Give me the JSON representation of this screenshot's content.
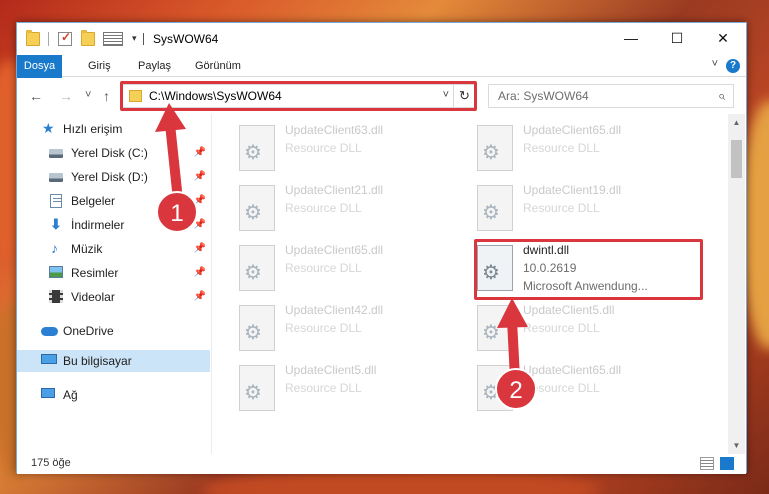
{
  "window": {
    "title": "SysWOW64",
    "minimize": "—",
    "maximize": "☐",
    "close": "✕"
  },
  "ribbon": {
    "tabs": [
      "Dosya",
      "Giriş",
      "Paylaş",
      "Görünüm"
    ],
    "help": "?"
  },
  "nav": {
    "back": "←",
    "forward": "→",
    "recent": "˅",
    "up": "↑",
    "address": "C:\\Windows\\SysWOW64",
    "address_dropdown": "˅",
    "refresh": "↻",
    "search_placeholder": "Ara: SysWOW64",
    "search_icon": "⌕"
  },
  "sidebar": {
    "items": [
      {
        "label": "Hızlı erişim",
        "icon": "star-icon",
        "pinned": false
      },
      {
        "label": "Yerel Disk (C:)",
        "icon": "drive-icon",
        "pinned": true
      },
      {
        "label": "Yerel Disk (D:)",
        "icon": "drive-icon",
        "pinned": true
      },
      {
        "label": "Belgeler",
        "icon": "documents-icon",
        "pinned": true
      },
      {
        "label": "İndirmeler",
        "icon": "download-icon",
        "pinned": true
      },
      {
        "label": "Müzik",
        "icon": "music-icon",
        "pinned": true
      },
      {
        "label": "Resimler",
        "icon": "pictures-icon",
        "pinned": true
      },
      {
        "label": "Videolar",
        "icon": "videos-icon",
        "pinned": true
      },
      {
        "label": "OneDrive",
        "icon": "cloud-icon",
        "pinned": false
      },
      {
        "label": "Bu bilgisayar",
        "icon": "computer-icon",
        "pinned": false,
        "selected": true
      },
      {
        "label": "Ağ",
        "icon": "network-icon",
        "pinned": false
      }
    ],
    "pin_glyph": "📌"
  },
  "files": [
    {
      "name": "UpdateClient63.dll",
      "type": "Resource DLL"
    },
    {
      "name": "UpdateClient65.dll",
      "type": "Resource DLL"
    },
    {
      "name": "UpdateClient21.dll",
      "type": "Resource DLL"
    },
    {
      "name": "UpdateClient19.dll",
      "type": "Resource DLL"
    },
    {
      "name": "UpdateClient65.dll",
      "type": "Resource DLL"
    },
    {
      "name": "dwintl.dll",
      "version": "10.0.2619",
      "company": "Microsoft Anwendung..."
    },
    {
      "name": "UpdateClient42.dll",
      "type": "Resource DLL"
    },
    {
      "name": "UpdateClient5.dll",
      "type": "Resource DLL"
    },
    {
      "name": "UpdateClient5.dll",
      "type": "Resource DLL"
    },
    {
      "name": "UpdateClient65.dll",
      "type": "Resource DLL"
    }
  ],
  "status": {
    "item_count": "175 öğe"
  },
  "annotations": {
    "badge1": "1",
    "badge2": "2",
    "color": "#d9363e"
  }
}
